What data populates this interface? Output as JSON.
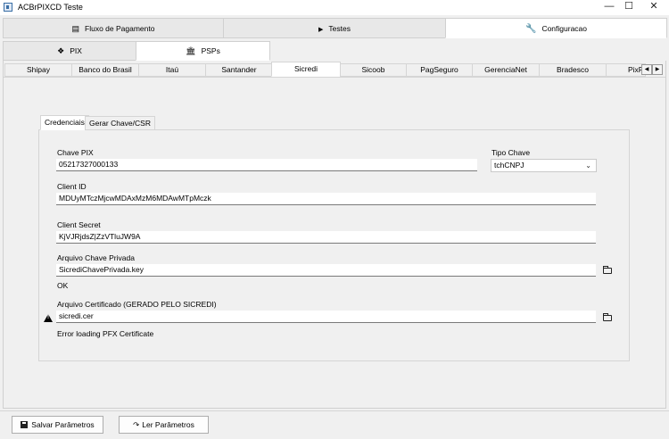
{
  "window": {
    "title": "ACBrPIXCD Teste",
    "controls": {
      "minimize": "—",
      "maximize": "☐",
      "close": "✕"
    }
  },
  "top_tabs": [
    {
      "label": "Fluxo de Pagamento",
      "icon": "list-icon"
    },
    {
      "label": "Testes",
      "icon": "play-icon"
    },
    {
      "label": "Configuracao",
      "icon": "wrench-icon"
    }
  ],
  "sub_tabs": [
    {
      "label": "PIX",
      "icon": "pix-icon"
    },
    {
      "label": "PSPs",
      "icon": "bank-icon"
    }
  ],
  "bank_tabs": [
    "Shipay",
    "Banco do Brasil",
    "Itaú",
    "Santander",
    "Sicredi",
    "Sicoob",
    "PagSeguro",
    "GerenciaNet",
    "Bradesco",
    "PixPDV"
  ],
  "bank_tabs_visible": [
    "Shipay",
    "Banco do Brasil",
    "Itaú",
    "Santander",
    "Sicredi",
    "Sicoob",
    "PagSeguro",
    "GerenciaNet",
    "Bradesco",
    "PixPD"
  ],
  "inner_tabs": [
    "Credenciais",
    "Gerar Chave/CSR"
  ],
  "form": {
    "chave_pix": {
      "label": "Chave PIX",
      "value": "05217327000133"
    },
    "tipo_chave": {
      "label": "Tipo Chave",
      "value": "tchCNPJ"
    },
    "client_id": {
      "label": "Client ID",
      "value": "MDUyMTczMjcwMDAxMzM6MDAwMTpMczk"
    },
    "client_secret": {
      "label": "Client Secret",
      "value": "KjVJRjdsZ|ZzVTluJW9A"
    },
    "arquivo_chave": {
      "label": "Arquivo Chave Privada",
      "value": "SicrediChavePrivada.key",
      "status": "OK"
    },
    "arquivo_cert": {
      "label": "Arquivo Certificado (GERADO PELO SICREDI)",
      "value": "sicredi.cer",
      "status": "Error loading PFX Certificate"
    }
  },
  "buttons": {
    "salvar": "Salvar Parâmetros",
    "ler": "Ler Parâmetros"
  }
}
